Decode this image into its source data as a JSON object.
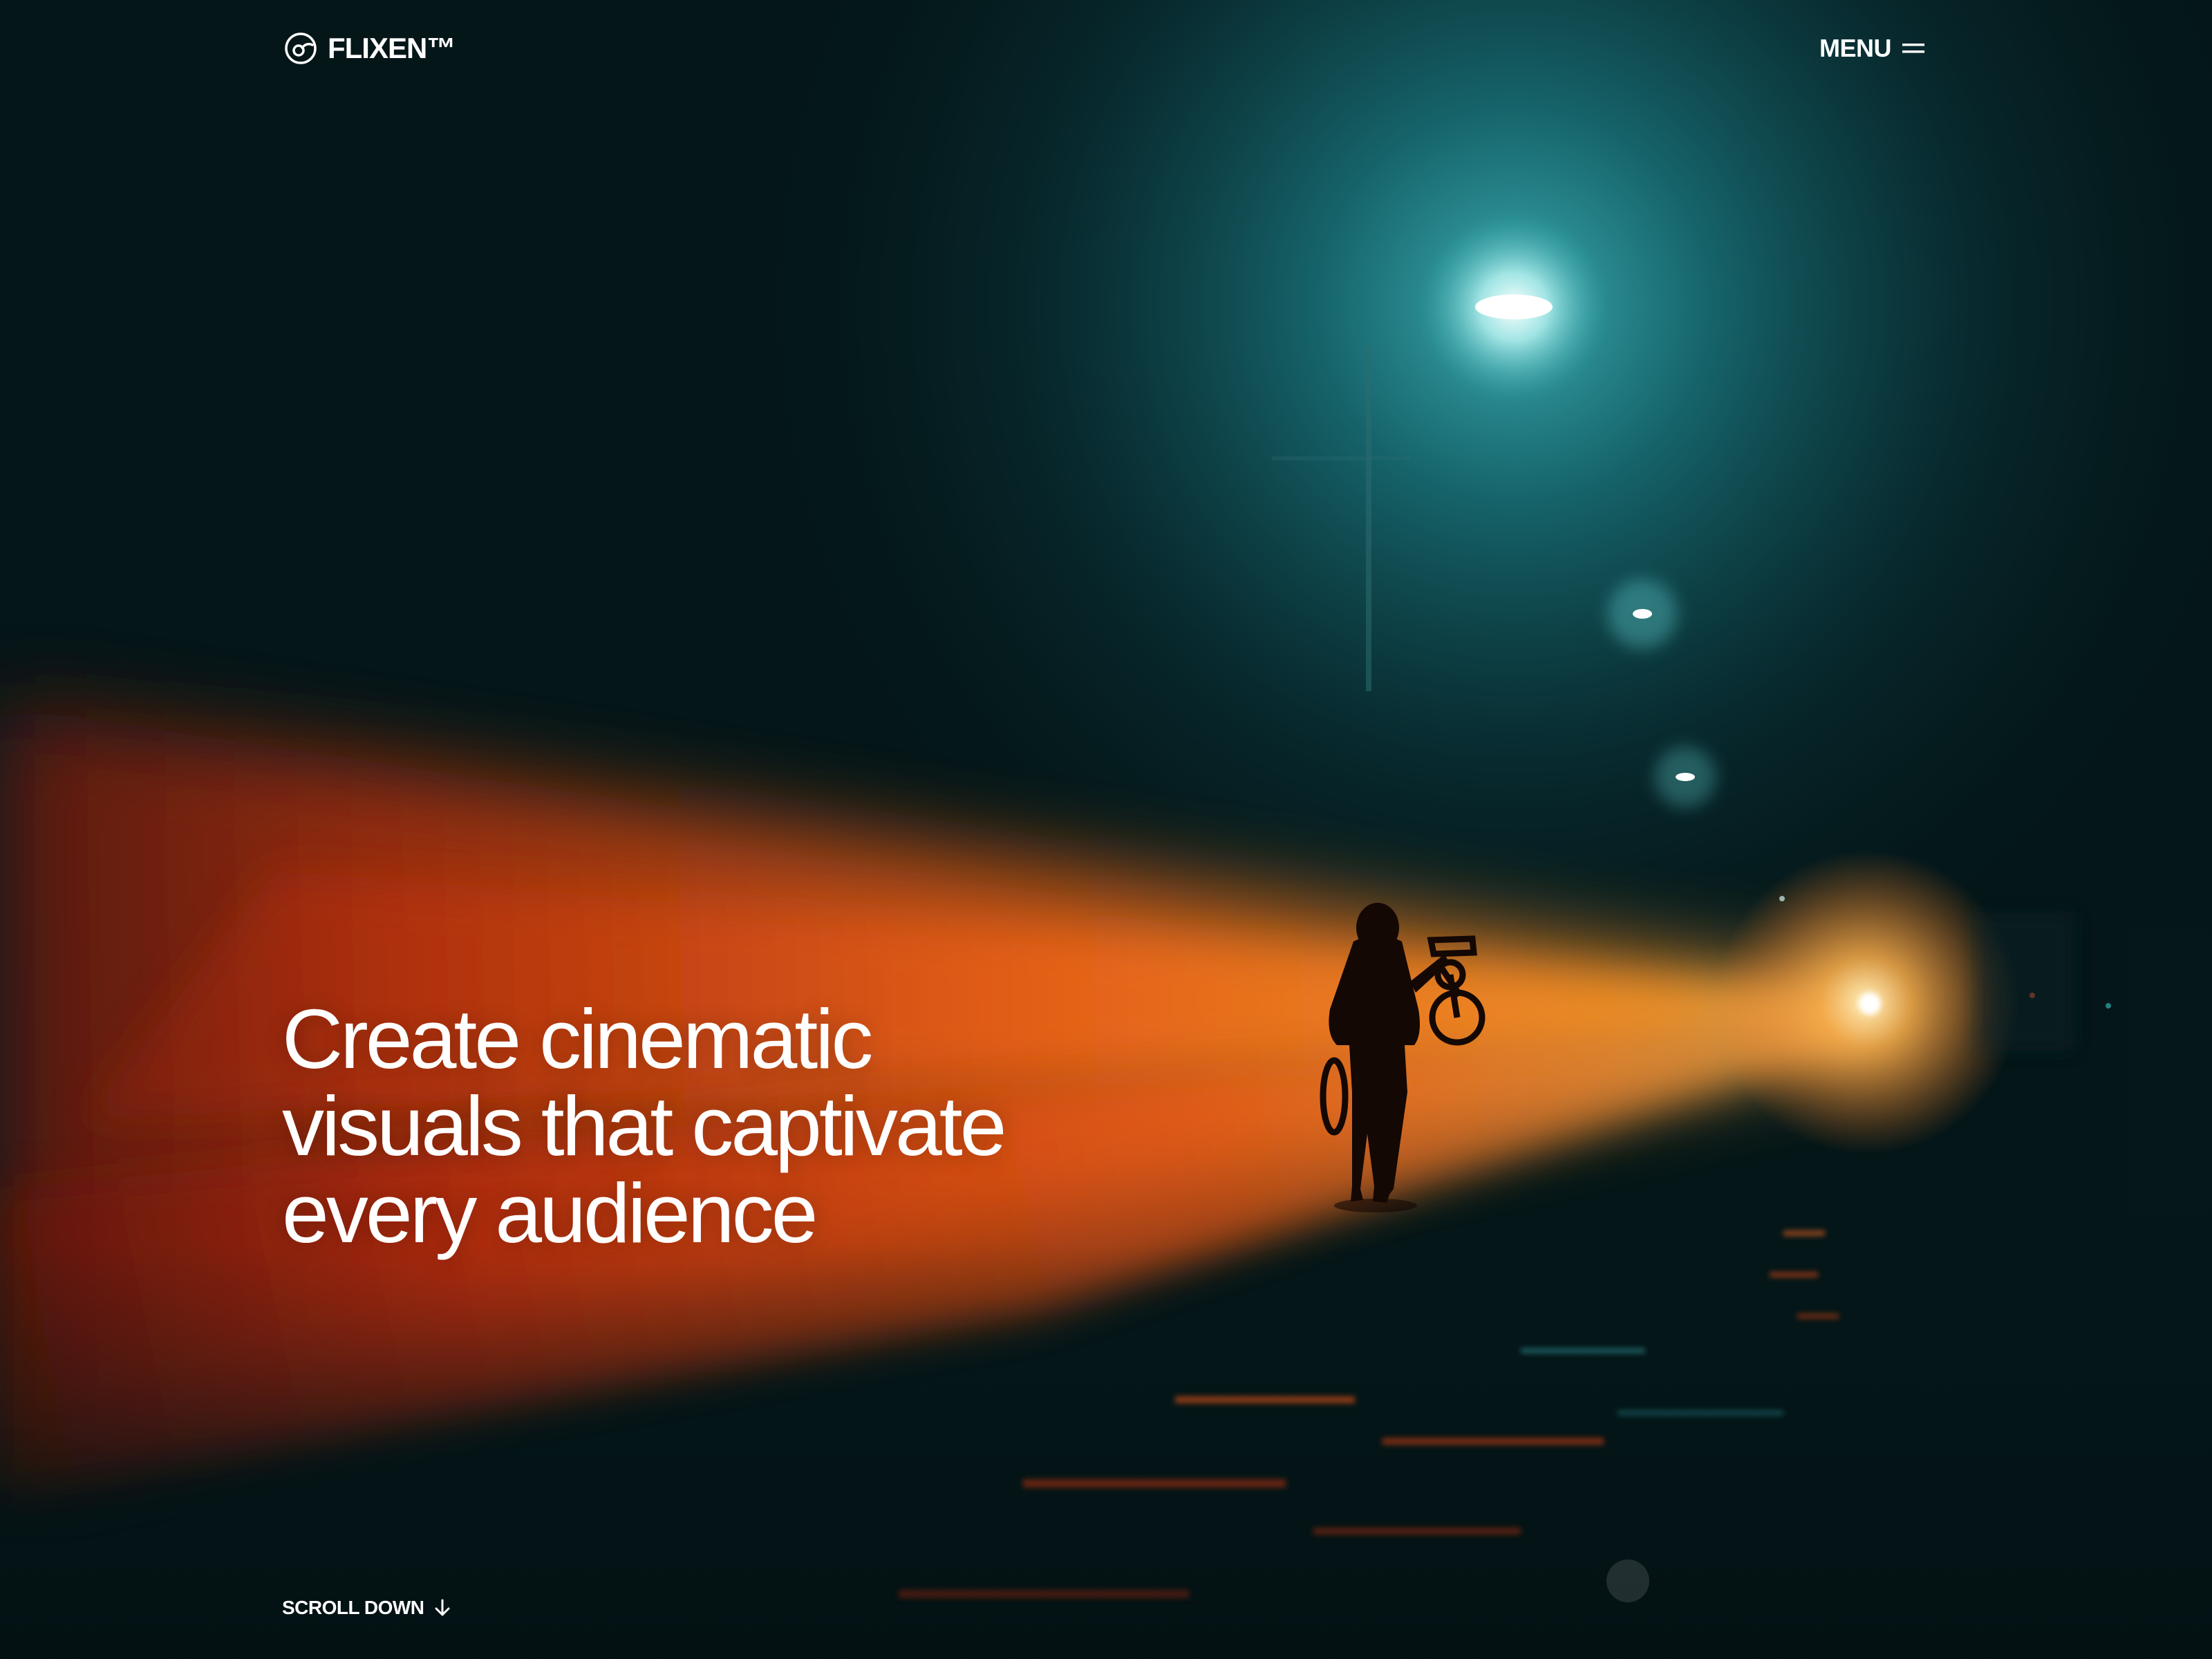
{
  "header": {
    "brand": "FLIXEN™",
    "logo_icon": "flixen-logo-icon",
    "menu_label": "MENU",
    "menu_icon": "hamburger-icon"
  },
  "hero": {
    "headline_lines": [
      "Create cinematic",
      "visuals that captivate",
      "every audience"
    ],
    "scroll_label": "SCROLL DOWN",
    "scroll_icon": "arrow-down-icon"
  },
  "colors": {
    "background": "#041618",
    "text": "#ffffff",
    "glow_orange": "#ff6a10",
    "glow_teal": "#1e8a92"
  }
}
